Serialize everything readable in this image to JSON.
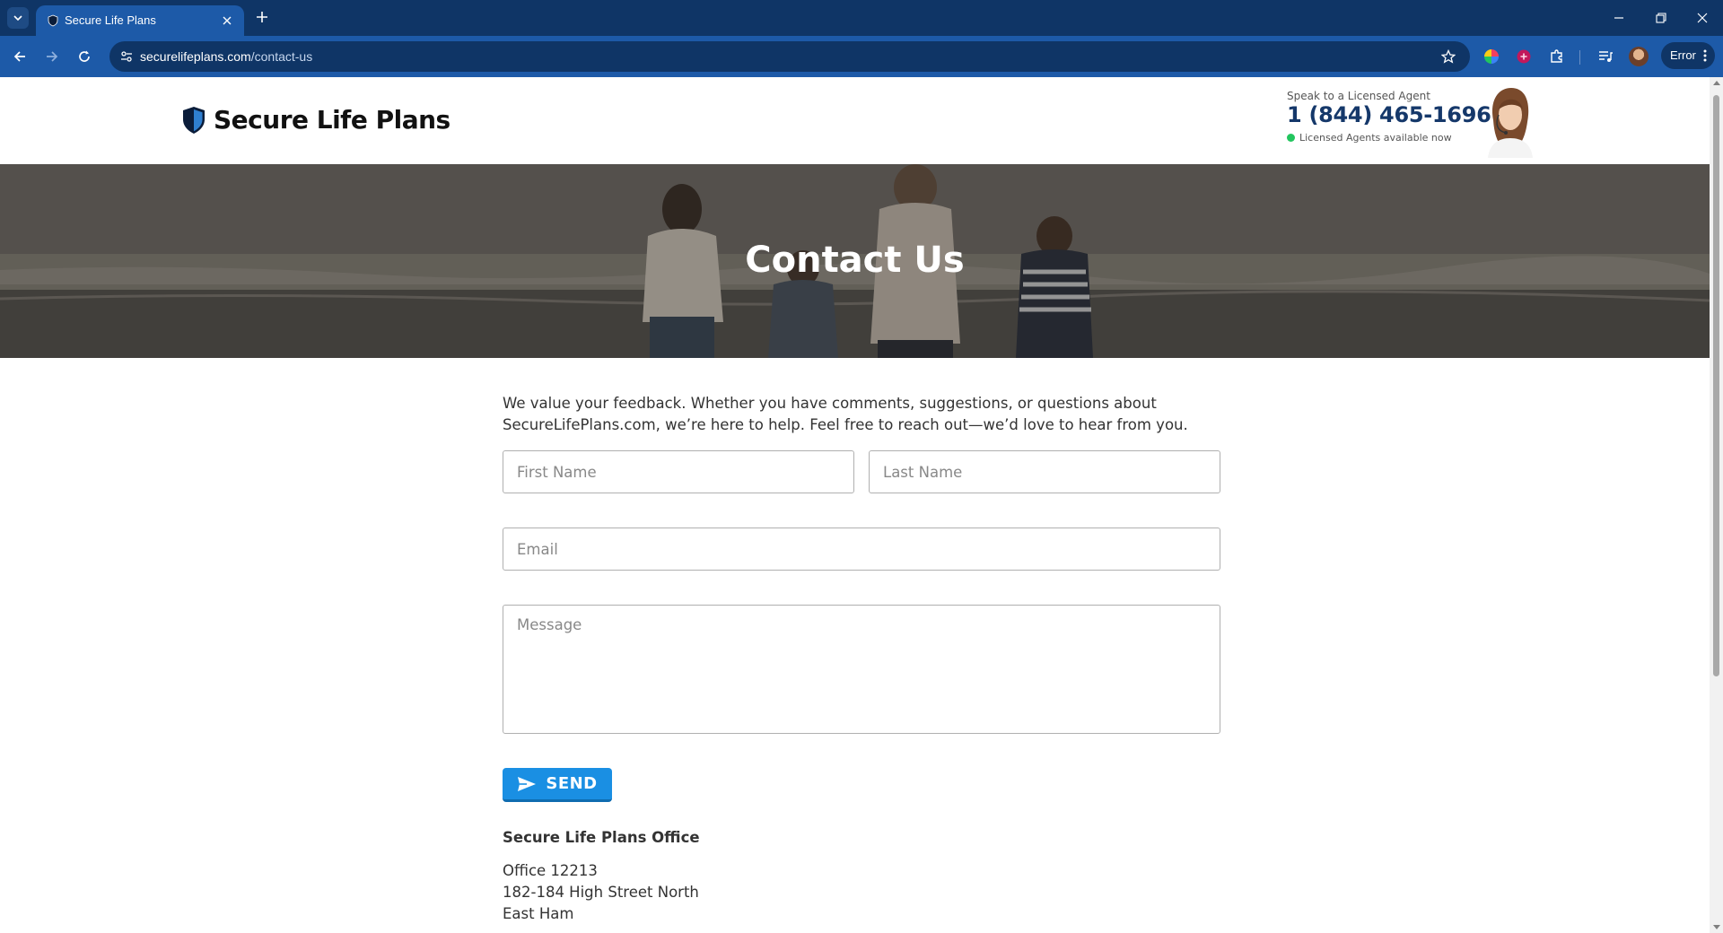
{
  "browser": {
    "tab_title": "Secure Life Plans",
    "url_domain": "securelifeplans.com",
    "url_path": "/contact-us",
    "profile_chip_label": "Error"
  },
  "header": {
    "logo_text": "Secure Life Plans",
    "agent_label": "Speak to a Licensed Agent",
    "agent_phone": "1 (844) 465-1696",
    "agent_status": "Licensed Agents available now"
  },
  "hero": {
    "title": "Contact Us"
  },
  "form": {
    "intro": "We value your feedback. Whether you have comments, suggestions, or questions about SecureLifePlans.com, we’re here to help. Feel free to reach out—we’d love to hear from you.",
    "first_name_placeholder": "First Name",
    "last_name_placeholder": "Last Name",
    "email_placeholder": "Email",
    "message_placeholder": "Message",
    "send_label": "SEND"
  },
  "office": {
    "title": "Secure Life Plans Office",
    "lines": [
      "Office 12213",
      "182-184 High Street North",
      "East Ham"
    ]
  },
  "colors": {
    "browser_frame": "#0f3566",
    "browser_toolbar": "#1d5aa8",
    "phone_text": "#15386a",
    "send_button": "#1a8fe3",
    "status_dot": "#22c55e"
  },
  "icons": {
    "tab_search": "chevron-down-icon",
    "favicon": "shield-icon",
    "tab_close": "close-icon",
    "new_tab": "plus-icon",
    "back": "arrow-left-icon",
    "forward": "arrow-right-icon",
    "reload": "reload-icon",
    "site_info": "tune-icon",
    "bookmark": "star-icon",
    "extensions": "puzzle-icon",
    "send": "paper-plane-icon"
  }
}
